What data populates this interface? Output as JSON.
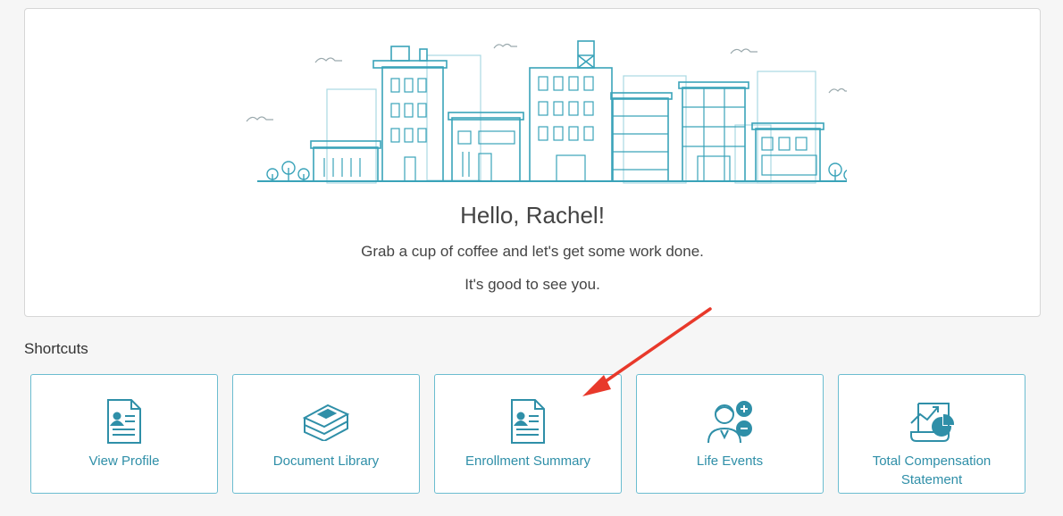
{
  "welcome": {
    "greeting": "Hello, Rachel!",
    "line1": "Grab a cup of coffee and let's get some work done.",
    "line2": "It's good to see you."
  },
  "shortcuts": {
    "title": "Shortcuts",
    "items": [
      {
        "label": "View Profile",
        "icon": "profile-document-icon"
      },
      {
        "label": "Document Library",
        "icon": "books-icon"
      },
      {
        "label": "Enrollment Summary",
        "icon": "profile-document-icon"
      },
      {
        "label": "Life Events",
        "icon": "person-plus-minus-icon"
      },
      {
        "label": "Total Compensation Statement",
        "icon": "chart-scroll-icon"
      }
    ]
  },
  "colors": {
    "accent": "#2f8fa8",
    "tile_border": "#6bbdd0",
    "annotation_arrow": "#e8392b"
  }
}
